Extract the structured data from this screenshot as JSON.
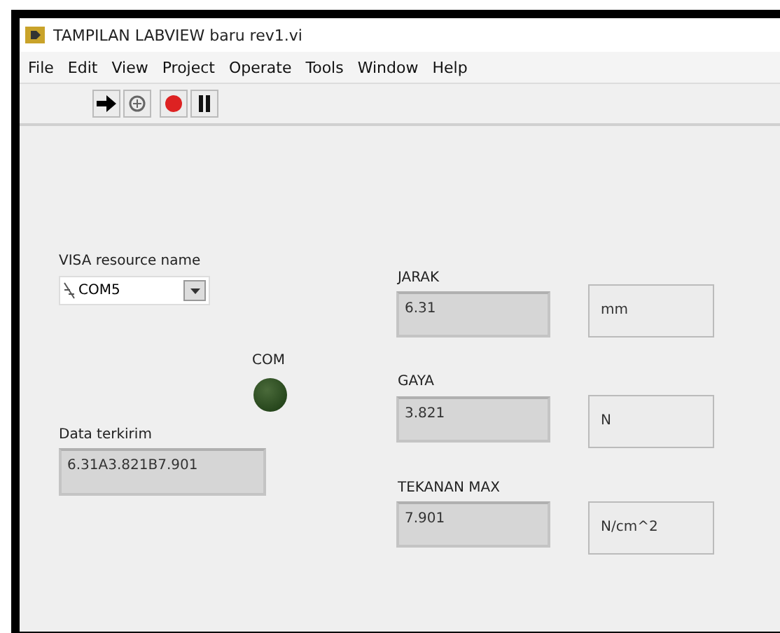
{
  "window": {
    "title": "TAMPILAN LABVIEW baru rev1.vi"
  },
  "menu": [
    "File",
    "Edit",
    "View",
    "Project",
    "Operate",
    "Tools",
    "Window",
    "Help"
  ],
  "visa": {
    "label": "VISA resource name",
    "value": "COM5"
  },
  "led": {
    "label": "COM",
    "on": false
  },
  "sent": {
    "label": "Data terkirim",
    "value": "6.31A3.821B7.901"
  },
  "readings": [
    {
      "label": "JARAK",
      "value": "6.31",
      "unit": "mm"
    },
    {
      "label": "GAYA",
      "value": "3.821",
      "unit": "N"
    },
    {
      "label": "TEKANAN MAX",
      "value": "7.901",
      "unit": "N/cm^2"
    }
  ]
}
